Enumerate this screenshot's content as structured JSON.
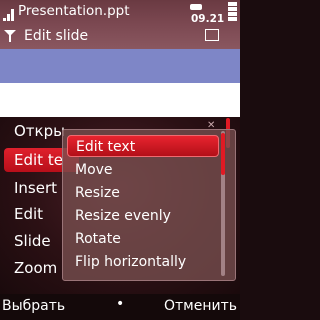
{
  "status": {
    "file_title": "Presentation.ppt",
    "subtitle": "Edit slide",
    "clock": "09.21"
  },
  "background_menu": {
    "items": [
      "Откры",
      "Edit te",
      "Insert",
      "Edit",
      "Slide",
      "Zoom"
    ],
    "selected_index": 1
  },
  "submenu": {
    "items": [
      "Edit text",
      "Move",
      "Resize",
      "Resize evenly",
      "Rotate",
      "Flip horizontally"
    ],
    "selected_index": 0
  },
  "softkeys": {
    "left": "Выбрать",
    "middle": "•",
    "right": "Отменить"
  },
  "colors": {
    "accent": "#e11a24",
    "slide_band": "#7e86c7"
  }
}
